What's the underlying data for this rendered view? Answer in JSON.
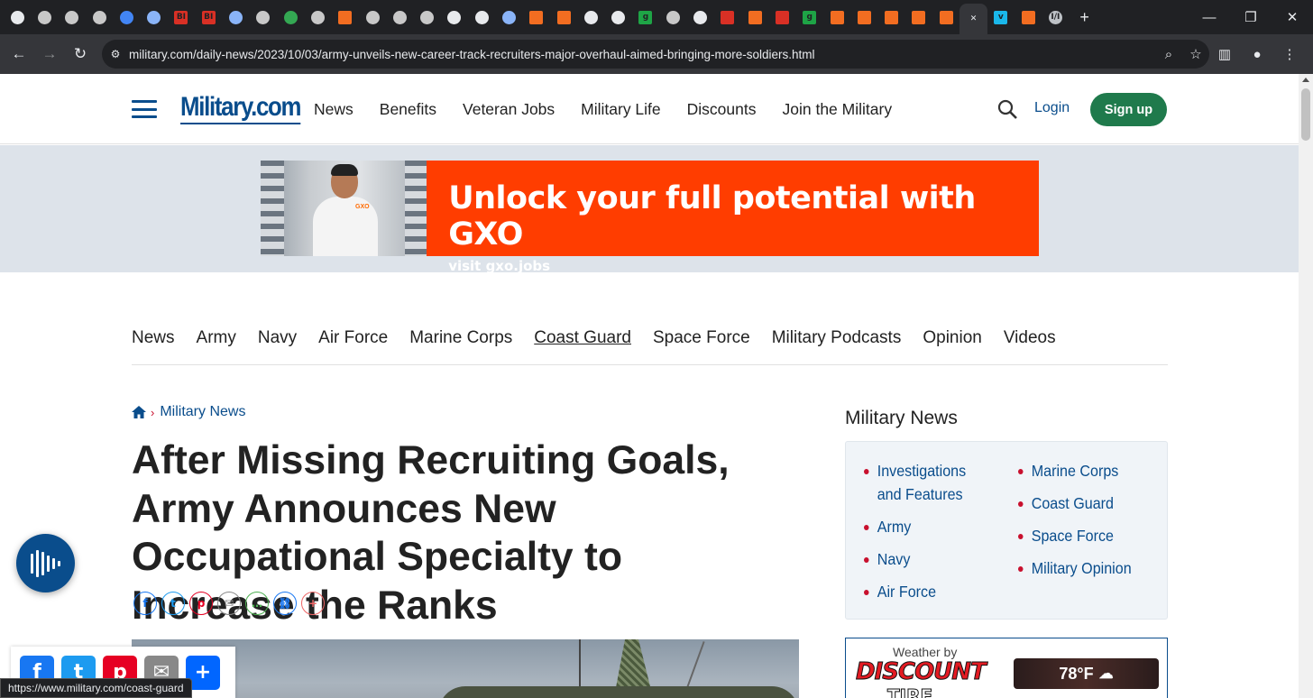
{
  "browser": {
    "tabs": [
      {
        "icon": "chevron-down-icon"
      },
      {
        "icon": "globe-icon"
      },
      {
        "icon": "globe-icon"
      },
      {
        "icon": "globe-icon"
      },
      {
        "icon": "arrow-icon"
      },
      {
        "icon": "search-icon"
      },
      {
        "icon": "bi-icon",
        "label": "BI"
      },
      {
        "icon": "bi-icon",
        "label": "BI"
      },
      {
        "icon": "search-icon"
      },
      {
        "icon": "globe-icon"
      },
      {
        "icon": "play-icon"
      },
      {
        "icon": "globe-icon"
      },
      {
        "icon": "bookmark-icon"
      },
      {
        "icon": "globe-icon"
      },
      {
        "icon": "globe-icon"
      },
      {
        "icon": "globe-icon"
      },
      {
        "icon": "shield-icon"
      },
      {
        "icon": "shield-icon"
      },
      {
        "icon": "search-icon"
      },
      {
        "icon": "bookmark-icon"
      },
      {
        "icon": "bookmark-icon"
      },
      {
        "icon": "shield-icon"
      },
      {
        "icon": "shield-icon"
      },
      {
        "icon": "g-icon",
        "label": "g"
      },
      {
        "icon": "globe-icon"
      },
      {
        "icon": "shield-icon"
      },
      {
        "icon": "pin-icon"
      },
      {
        "icon": "bookmark-icon"
      },
      {
        "icon": "pin-icon"
      },
      {
        "icon": "g-icon",
        "label": "g"
      },
      {
        "icon": "bookmark-icon"
      },
      {
        "icon": "bookmark-icon"
      },
      {
        "icon": "bookmark-icon"
      },
      {
        "icon": "bookmark-icon"
      },
      {
        "icon": "bookmark-icon"
      },
      {
        "icon": "close-icon",
        "label": "✕",
        "active": true
      },
      {
        "icon": "v-icon",
        "label": "v"
      },
      {
        "icon": "bookmark-icon"
      },
      {
        "icon": "italic-icon",
        "label": "I/I"
      }
    ],
    "url": "military.com/daily-news/2023/10/03/army-unveils-new-career-track-recruiters-major-overhaul-aimed-bringing-more-soldiers.html",
    "status_url": "https://www.military.com/coast-guard"
  },
  "header": {
    "logo": "Military.com",
    "nav": [
      "News",
      "Benefits",
      "Veteran Jobs",
      "Military Life",
      "Discounts",
      "Join the Military"
    ],
    "login": "Login",
    "signup": "Sign up"
  },
  "ad": {
    "headline": "Unlock your full potential with GXO",
    "sub": "visit gxo.jobs",
    "badge": "GXO",
    "color": "#ff3d00"
  },
  "secondary_nav": [
    "News",
    "Army",
    "Navy",
    "Air Force",
    "Marine Corps",
    "Coast Guard",
    "Space Force",
    "Military Podcasts",
    "Opinion",
    "Videos"
  ],
  "breadcrumb": {
    "section": "Military News"
  },
  "article": {
    "title": "After Missing Recruiting Goals, Army Announces New Occupational Specialty to Increase the Ranks",
    "share_icons": [
      "f",
      "t",
      "p",
      "✉",
      "…",
      "⛓",
      "+"
    ]
  },
  "sidebar": {
    "title": "Military News",
    "col1": [
      "Investigations and Features",
      "Army",
      "Navy",
      "Air Force"
    ],
    "col2": [
      "Marine Corps",
      "Coast Guard",
      "Space Force",
      "Military Opinion"
    ]
  },
  "weather": {
    "by": "Weather by",
    "brand": "DISCOUNT",
    "brand2": "TIRE",
    "temp": "78°F"
  },
  "colors": {
    "brand_blue": "#0a4d8c",
    "signup_green": "#1f7a4c",
    "bullet_red": "#c8102e"
  }
}
